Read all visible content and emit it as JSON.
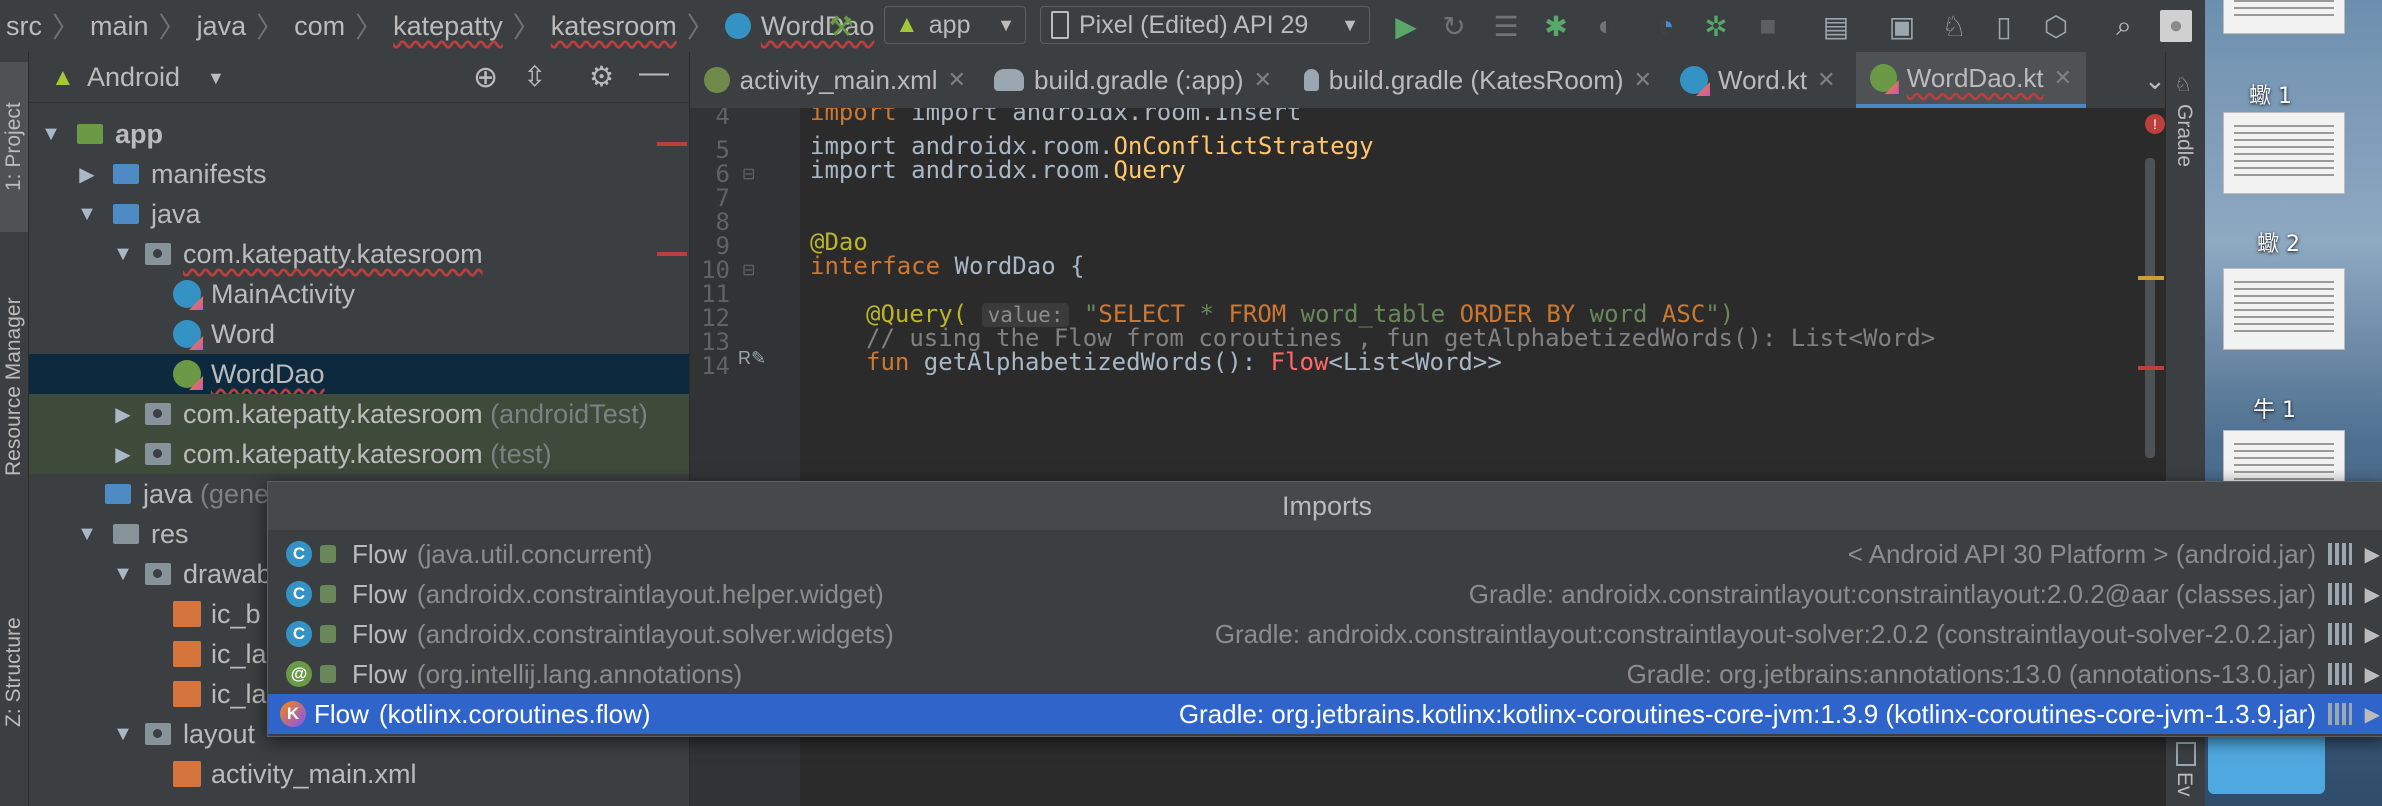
{
  "breadcrumb": [
    "src",
    "main",
    "java",
    "com",
    "katepatty",
    "katesroom",
    "WordDao"
  ],
  "run_config": "app",
  "device": "Pixel (Edited) API 29",
  "left_tabs": {
    "project": "1: Project",
    "resource_manager": "Resource Manager",
    "structure": "Z: Structure"
  },
  "right_tabs": {
    "gradle": "Gradle",
    "event": "Ev"
  },
  "project_panel": {
    "view": "Android",
    "tree": [
      {
        "label": "app",
        "suffix": ""
      },
      {
        "label": "manifests",
        "suffix": ""
      },
      {
        "label": "java",
        "suffix": ""
      },
      {
        "label": "com.katepatty.katesroom",
        "suffix": ""
      },
      {
        "label": "MainActivity",
        "suffix": ""
      },
      {
        "label": "Word",
        "suffix": ""
      },
      {
        "label": "WordDao",
        "suffix": ""
      },
      {
        "label": "com.katepatty.katesroom",
        "suffix": "(androidTest)"
      },
      {
        "label": "com.katepatty.katesroom",
        "suffix": "(test)"
      },
      {
        "label": "java",
        "suffix": "(gene"
      },
      {
        "label": "res",
        "suffix": ""
      },
      {
        "label": "drawab",
        "suffix": ""
      },
      {
        "label": "ic_b",
        "suffix": ""
      },
      {
        "label": "ic_la",
        "suffix": ""
      },
      {
        "label": "ic_la",
        "suffix": ""
      },
      {
        "label": "layout",
        "suffix": ""
      },
      {
        "label": "activity_main.xml",
        "suffix": ""
      }
    ]
  },
  "editor_tabs": [
    {
      "label": "activity_main.xml"
    },
    {
      "label": "build.gradle (:app)"
    },
    {
      "label": "build.gradle (KatesRoom)"
    },
    {
      "label": "Word.kt"
    },
    {
      "label": "WordDao.kt"
    }
  ],
  "code": {
    "line_numbers": [
      "4",
      "5",
      "6",
      "7",
      "8",
      "9",
      "10",
      "11",
      "12",
      "13",
      "14"
    ],
    "l4": "import androidx.room.Insert",
    "l5_prefix": "import androidx.room.",
    "l5_name": "OnConflictStrategy",
    "l6_prefix": "import androidx.room.",
    "l6_name": "Query",
    "l9": "@Dao",
    "l10_kw": "interface",
    "l10_rest": " WordDao {",
    "l12_ann": "@Query(",
    "l12_hint": "value:",
    "l12_q1": "\"",
    "l12_s1": "SELECT",
    "l12_s2": " * ",
    "l12_s3": "FROM",
    "l12_s4": " word_table ",
    "l12_s5": "ORDER BY",
    "l12_s6": " word ",
    "l12_s7": "ASC",
    "l12_q2": "\")",
    "l13": "// using the Flow from coroutines , fun getAlphabetizedWords(): List<Word>",
    "l14_kw": "fun",
    "l14_fn": " getAlphabetizedWords(): ",
    "l14_err": "Flow",
    "l14_rest": "<List<Word>>"
  },
  "popup": {
    "title": "Imports",
    "rows": [
      {
        "icon": "C",
        "name": "Flow",
        "pkg": "(java.util.concurrent)",
        "source": "< Android API 30 Platform > (android.jar)"
      },
      {
        "icon": "C",
        "name": "Flow",
        "pkg": "(androidx.constraintlayout.helper.widget)",
        "source": "Gradle: androidx.constraintlayout:constraintlayout:2.0.2@aar (classes.jar)"
      },
      {
        "icon": "C",
        "name": "Flow",
        "pkg": "(androidx.constraintlayout.solver.widgets)",
        "source": "Gradle: androidx.constraintlayout:constraintlayout-solver:2.0.2 (constraintlayout-solver-2.0.2.jar)"
      },
      {
        "icon": "@",
        "name": "Flow",
        "pkg": "(org.intellij.lang.annotations)",
        "source": "Gradle: org.jetbrains:annotations:13.0 (annotations-13.0.jar)"
      },
      {
        "icon": "K",
        "name": "Flow",
        "pkg": "(kotlinx.coroutines.flow)",
        "source": "Gradle: org.jetbrains.kotlinx:kotlinx-coroutines-core-jvm:1.3.9 (kotlinx-coroutines-core-jvm-1.3.9.jar)"
      }
    ]
  },
  "desktop": {
    "labels": [
      "蠍 1",
      "蠍 2",
      "牛 1"
    ]
  },
  "colors": {
    "accent": "#2f65ca",
    "keyword": "#cc7832",
    "string": "#6a8759",
    "error": "#bc3f3c"
  }
}
